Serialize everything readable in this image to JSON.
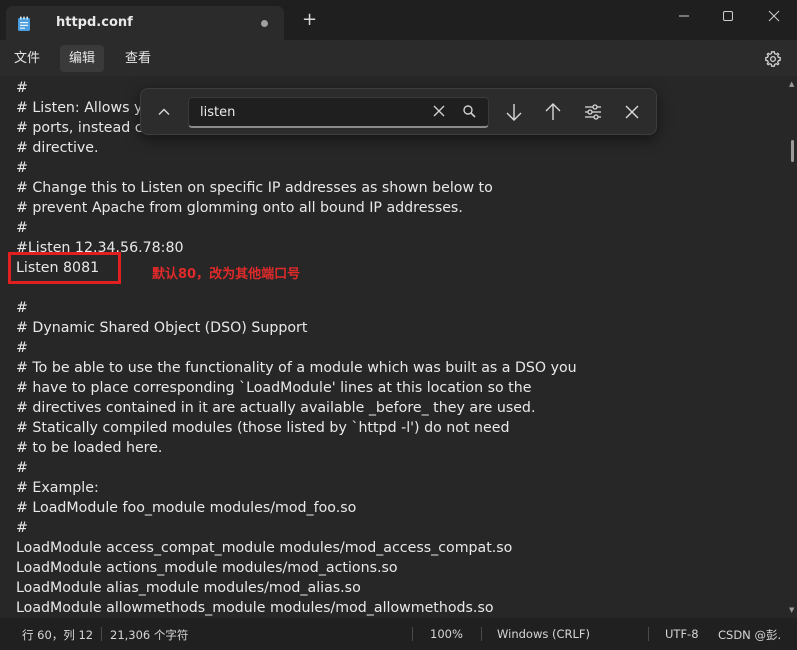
{
  "tab": {
    "title": "httpd.conf"
  },
  "menu": {
    "items": [
      "文件",
      "编辑",
      "查看"
    ],
    "active_index": 1
  },
  "editor": {
    "lines": [
      "#",
      "# Listen: Allows y",
      "# ports, instead c",
      "# directive.",
      "#",
      "# Change this to Listen on specific IP addresses as shown below to",
      "# prevent Apache from glomming onto all bound IP addresses.",
      "#",
      "#Listen 12.34.56.78:80",
      "Listen 8081",
      "",
      "#",
      "# Dynamic Shared Object (DSO) Support",
      "#",
      "# To be able to use the functionality of a module which was built as a DSO you",
      "# have to place corresponding `LoadModule' lines at this location so the",
      "# directives contained in it are actually available _before_ they are used.",
      "# Statically compiled modules (those listed by `httpd -l') do not need",
      "# to be loaded here.",
      "#",
      "# Example:",
      "# LoadModule foo_module modules/mod_foo.so",
      "#",
      "LoadModule access_compat_module modules/mod_access_compat.so",
      "LoadModule actions_module modules/mod_actions.so",
      "LoadModule alias_module modules/mod_alias.so",
      "LoadModule allowmethods_module modules/mod_allowmethods.so"
    ]
  },
  "annotation": {
    "text": "默认80，改为其他端口号",
    "color": "#e02020"
  },
  "find": {
    "query": "listen"
  },
  "status": {
    "position": "行 60，列 12",
    "char_count": "21,306 个字符",
    "zoom": "100%",
    "line_ending": "Windows (CRLF)",
    "encoding": "UTF-8",
    "watermark": "CSDN @彭."
  },
  "colors": {
    "background": "#272727",
    "accent": "#4a9ee0",
    "annotation": "#e02020"
  }
}
